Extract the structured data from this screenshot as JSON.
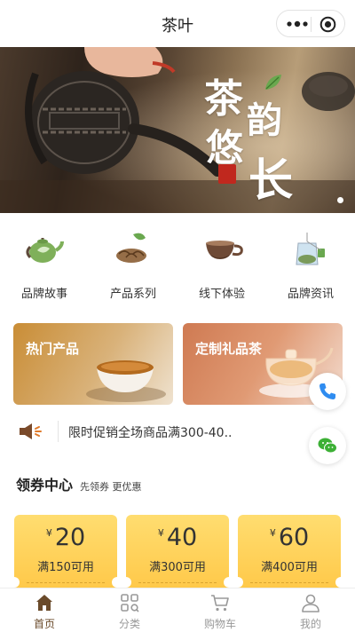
{
  "header": {
    "title": "茶叶"
  },
  "banner": {
    "calligraphy": [
      "茶",
      "韵",
      "悠",
      "长"
    ],
    "seal": "品茗之道"
  },
  "categories": [
    {
      "label": "品牌故事",
      "icon": "teapot-icon"
    },
    {
      "label": "产品系列",
      "icon": "tea-leaves-icon"
    },
    {
      "label": "线下体验",
      "icon": "tea-cup-icon"
    },
    {
      "label": "品牌资讯",
      "icon": "tea-bag-icon"
    }
  ],
  "cards": [
    {
      "title": "热门产品"
    },
    {
      "title": "定制礼品茶"
    }
  ],
  "notice": {
    "text": "限时促销全场商品满300-40.."
  },
  "coupon_section": {
    "title": "领券中心",
    "subtitle": "先领券 更优惠"
  },
  "coupons": [
    {
      "currency": "¥",
      "amount": "20",
      "condition": "满150可用"
    },
    {
      "currency": "¥",
      "amount": "40",
      "condition": "满300可用"
    },
    {
      "currency": "¥",
      "amount": "60",
      "condition": "满400可用"
    }
  ],
  "tabbar": [
    {
      "label": "首页",
      "icon": "home-icon",
      "active": true
    },
    {
      "label": "分类",
      "icon": "grid-icon",
      "active": false
    },
    {
      "label": "购物车",
      "icon": "cart-icon",
      "active": false
    },
    {
      "label": "我的",
      "icon": "user-icon",
      "active": false
    }
  ],
  "colors": {
    "accent": "#6a4a2a",
    "coupon": "#ffd35c",
    "leaf_green": "#6aa84f"
  }
}
